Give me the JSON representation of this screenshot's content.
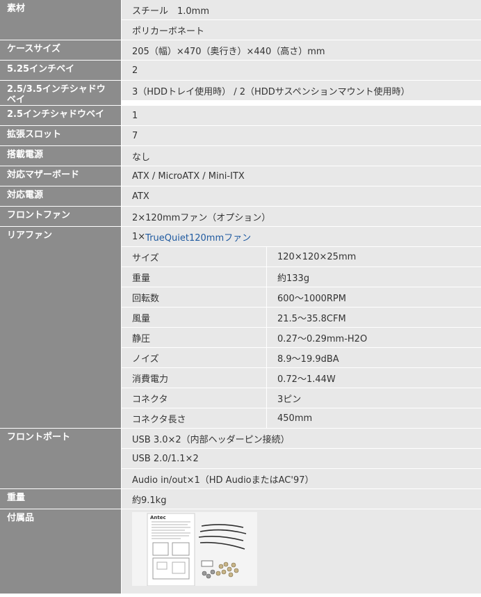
{
  "rows": [
    {
      "label": "素材",
      "values": [
        "スチール　1.0mm",
        "ポリカーボネート"
      ]
    },
    {
      "label": "ケースサイズ",
      "values": [
        "205（幅）×470（奥行き）×440（高さ）mm"
      ]
    },
    {
      "label": "5.25インチベイ",
      "values": [
        "2"
      ]
    },
    {
      "label": "2.5/3.5インチシャドウベイ",
      "values": [
        "3（HDDトレイ使用時） / 2（HDDサスペンションマウント使用時）"
      ]
    },
    {
      "label": "2.5インチシャドウベイ",
      "values": [
        "1"
      ]
    },
    {
      "label": "拡張スロット",
      "values": [
        "7"
      ]
    },
    {
      "label": "搭載電源",
      "values": [
        "なし"
      ]
    },
    {
      "label": "対応マザーボード",
      "values": [
        "ATX / MicroATX / Mini-ITX"
      ]
    },
    {
      "label": "対応電源",
      "values": [
        "ATX"
      ]
    },
    {
      "label": "フロントファン",
      "values": [
        "2×120mmファン（オプション）"
      ]
    }
  ],
  "rear_fan": {
    "label": "リアファン",
    "prefix": "1×",
    "link": "TrueQuiet120mmファン",
    "specs": [
      {
        "k": "サイズ",
        "v": "120×120×25mm"
      },
      {
        "k": "重量",
        "v": "約133g"
      },
      {
        "k": "回転数",
        "v": "600～1000RPM"
      },
      {
        "k": "風量",
        "v": "21.5～35.8CFM"
      },
      {
        "k": "静圧",
        "v": "0.27～0.29mm-H2O"
      },
      {
        "k": "ノイズ",
        "v": "8.9～19.9dBA"
      },
      {
        "k": "消費電力",
        "v": "0.72～1.44W"
      },
      {
        "k": "コネクタ",
        "v": "3ピン"
      },
      {
        "k": "コネクタ長さ",
        "v": "450mm"
      }
    ]
  },
  "rows2": [
    {
      "label": "フロントポート",
      "values": [
        "USB 3.0×2（内部ヘッダーピン接続）",
        "USB 2.0/1.1×2",
        "Audio in/out×1（HD AudioまたはAC'97）"
      ]
    },
    {
      "label": "重量",
      "values": [
        "約9.1kg"
      ]
    }
  ],
  "accessories": {
    "label": "付属品",
    "logo_text": "Antec"
  }
}
